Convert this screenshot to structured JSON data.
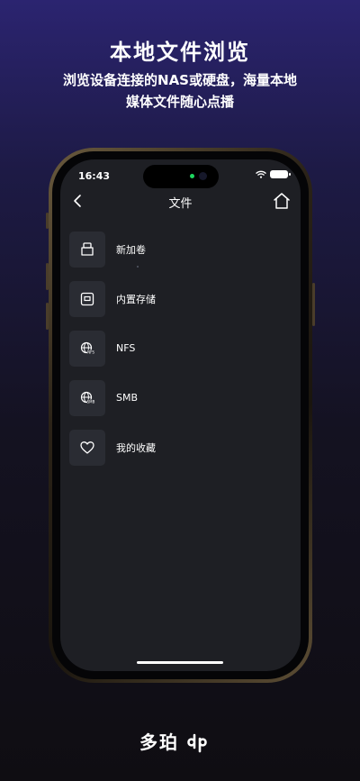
{
  "promo": {
    "headline": "本地文件浏览",
    "subline_1": "浏览设备连接的NAS或硬盘，海量本地",
    "subline_2": "媒体文件随心点播"
  },
  "status_bar": {
    "time": "16:43"
  },
  "nav": {
    "title": "文件",
    "back_icon": "chevron-left-icon",
    "home_icon": "home-icon"
  },
  "file_sources": [
    {
      "label": "新加卷",
      "icon": "usb-drive-icon"
    },
    {
      "label": "内置存储",
      "icon": "storage-box-icon"
    },
    {
      "label": "NFS",
      "icon": "globe-nfs-icon"
    },
    {
      "label": "SMB",
      "icon": "globe-smb-icon"
    },
    {
      "label": "我的收藏",
      "icon": "heart-icon"
    }
  ],
  "brand": {
    "name": "多珀"
  },
  "colors": {
    "background_top": "#2b2470",
    "background_bottom": "#0f0d12",
    "screen_bg": "#1e1f24",
    "icon_box_bg": "#2a2c33",
    "camera_indicator": "#1ed760"
  }
}
